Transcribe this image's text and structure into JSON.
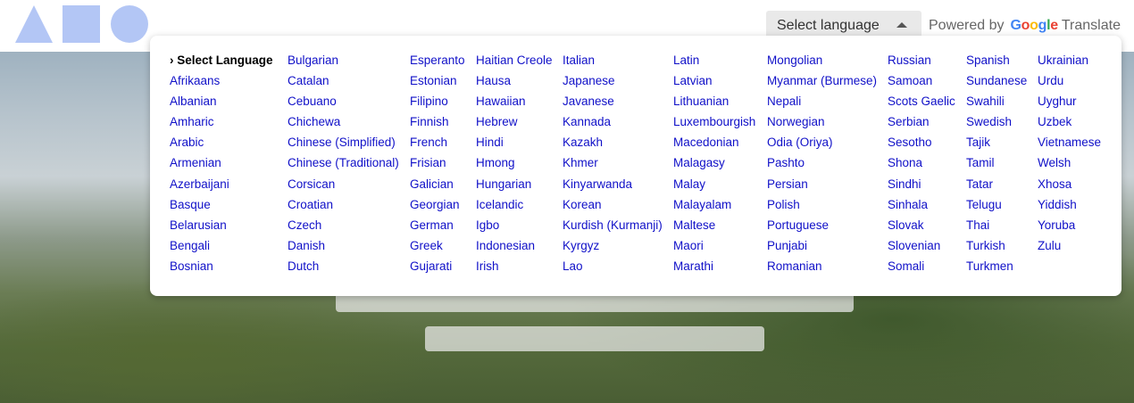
{
  "header": {
    "language_select_label": "Select language",
    "powered_by": "Powered by",
    "google_letters": [
      "G",
      "o",
      "o",
      "g",
      "l",
      "e"
    ],
    "translate_word": "Translate"
  },
  "logo": {
    "shapes": [
      "triangle-icon",
      "square-icon",
      "circle-icon"
    ],
    "color": "#b3c6f5"
  },
  "menu": {
    "columns": [
      [
        "› Select Language",
        "Afrikaans",
        "Albanian",
        "Amharic",
        "Arabic",
        "Armenian",
        "Azerbaijani",
        "Basque",
        "Belarusian",
        "Bengali",
        "Bosnian"
      ],
      [
        "Bulgarian",
        "Catalan",
        "Cebuano",
        "Chichewa",
        "Chinese (Simplified)",
        "Chinese (Traditional)",
        "Corsican",
        "Croatian",
        "Czech",
        "Danish",
        "Dutch"
      ],
      [
        "Esperanto",
        "Estonian",
        "Filipino",
        "Finnish",
        "French",
        "Frisian",
        "Galician",
        "Georgian",
        "German",
        "Greek",
        "Gujarati"
      ],
      [
        "Haitian Creole",
        "Hausa",
        "Hawaiian",
        "Hebrew",
        "Hindi",
        "Hmong",
        "Hungarian",
        "Icelandic",
        "Igbo",
        "Indonesian",
        "Irish"
      ],
      [
        "Italian",
        "Japanese",
        "Javanese",
        "Kannada",
        "Kazakh",
        "Khmer",
        "Kinyarwanda",
        "Korean",
        "Kurdish (Kurmanji)",
        "Kyrgyz",
        "Lao"
      ],
      [
        "Latin",
        "Latvian",
        "Lithuanian",
        "Luxembourgish",
        "Macedonian",
        "Malagasy",
        "Malay",
        "Malayalam",
        "Maltese",
        "Maori",
        "Marathi"
      ],
      [
        "Mongolian",
        "Myanmar (Burmese)",
        "Nepali",
        "Norwegian",
        "Odia (Oriya)",
        "Pashto",
        "Persian",
        "Polish",
        "Portuguese",
        "Punjabi",
        "Romanian"
      ],
      [
        "Russian",
        "Samoan",
        "Scots Gaelic",
        "Serbian",
        "Sesotho",
        "Shona",
        "Sindhi",
        "Sinhala",
        "Slovak",
        "Slovenian",
        "Somali"
      ],
      [
        "Spanish",
        "Sundanese",
        "Swahili",
        "Swedish",
        "Tajik",
        "Tamil",
        "Tatar",
        "Telugu",
        "Thai",
        "Turkish",
        "Turkmen"
      ],
      [
        "Ukrainian",
        "Urdu",
        "Uyghur",
        "Uzbek",
        "Vietnamese",
        "Welsh",
        "Xhosa",
        "Yiddish",
        "Yoruba",
        "Zulu"
      ]
    ],
    "link_color": "#1010c8"
  }
}
